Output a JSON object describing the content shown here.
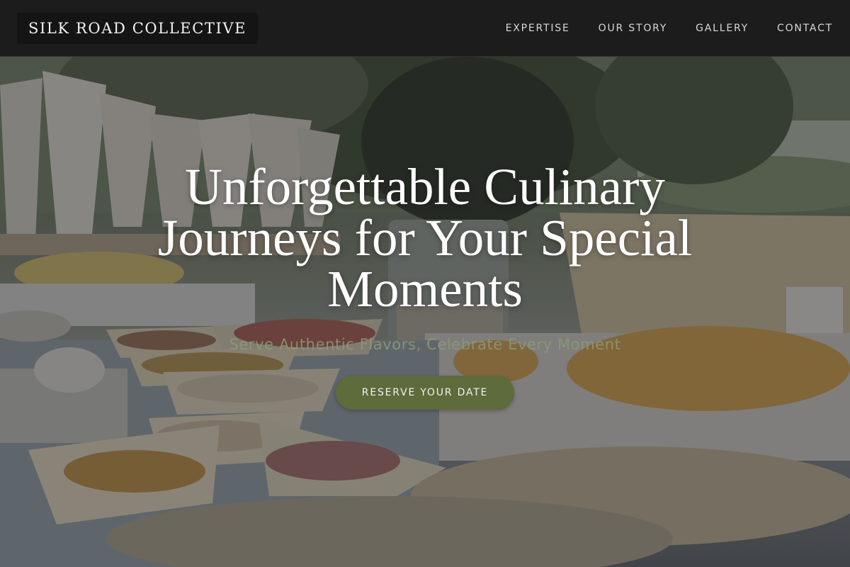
{
  "header": {
    "brand": "SILK ROAD COLLECTIVE",
    "nav": [
      {
        "label": "EXPERTISE"
      },
      {
        "label": "OUR STORY"
      },
      {
        "label": "GALLERY"
      },
      {
        "label": "CONTACT"
      }
    ]
  },
  "hero": {
    "title_lines": [
      "Unforgettable Culinary",
      "Journeys for Your Special",
      "Moments"
    ],
    "subtitle": "Serve Authentic Flavors, Celebrate Every Moment",
    "cta_label": "RESERVE YOUR DATE"
  },
  "colors": {
    "header_bg": "#1c1c1c",
    "accent": "#5e6b3a",
    "subtitle": "#8e9a76"
  }
}
